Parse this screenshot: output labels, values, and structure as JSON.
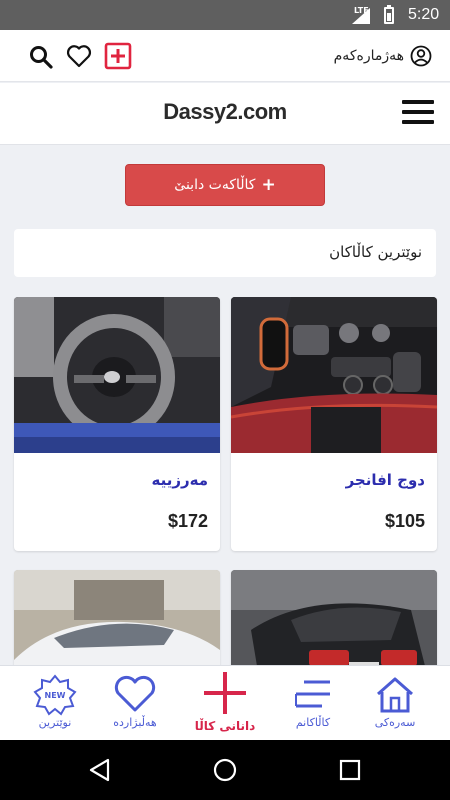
{
  "status_bar": {
    "network": "LTE",
    "time": "5:20"
  },
  "topbar": {
    "account_label": "هەژمارەکەم",
    "icons": [
      "search-icon",
      "heart-icon",
      "add-box-icon",
      "user-circle-icon"
    ]
  },
  "header": {
    "logo": "Dassy2.com",
    "menu_icon": "hamburger-icon"
  },
  "add_product": {
    "label": "کاڵاکەت دابنێ",
    "icon": "+"
  },
  "section": {
    "title": "نوێترین کاڵاکان"
  },
  "products": [
    {
      "name": "دوج افانجر",
      "price": "$105"
    },
    {
      "name": "مەرزییە",
      "price": "$172"
    },
    {
      "name": "",
      "price": ""
    },
    {
      "name": "",
      "price": ""
    }
  ],
  "bottom_nav": [
    {
      "label": "سەرەکی",
      "icon": "home-icon"
    },
    {
      "label": "کاڵاکانم",
      "icon": "my-products-icon"
    },
    {
      "label": "دانانی کاڵا",
      "icon": "add-icon"
    },
    {
      "label": "هەڵبژاردە",
      "icon": "heart-icon"
    },
    {
      "label": "نوێترین",
      "icon": "new-badge-icon",
      "badge": "NEW"
    }
  ],
  "colors": {
    "accent_red": "#d84a4a",
    "nav_blue": "#4b5bd4",
    "add_pink": "#d7264b",
    "title_blue": "#2c2dae"
  }
}
